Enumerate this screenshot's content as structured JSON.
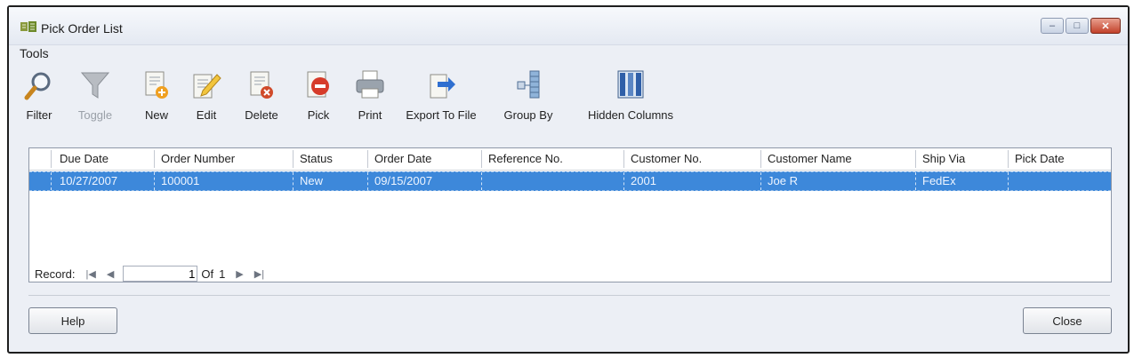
{
  "window": {
    "title": "Pick Order List",
    "controls": {
      "minimize": "–",
      "maximize": "□",
      "close": "✕"
    }
  },
  "menu": {
    "tools": "Tools"
  },
  "toolbar": {
    "items": [
      {
        "label": "Filter",
        "icon": "magnifier-icon"
      },
      {
        "label": "Toggle",
        "icon": "funnel-icon",
        "disabled": true
      },
      {
        "label": "New",
        "icon": "new-document-icon"
      },
      {
        "label": "Edit",
        "icon": "edit-pencil-icon"
      },
      {
        "label": "Delete",
        "icon": "delete-document-icon"
      },
      {
        "label": "Pick",
        "icon": "pick-stop-icon"
      },
      {
        "label": "Print",
        "icon": "printer-icon"
      },
      {
        "label": "Export To File",
        "icon": "export-arrow-icon"
      },
      {
        "label": "Group By",
        "icon": "group-by-icon"
      },
      {
        "label": "Hidden Columns",
        "icon": "columns-icon"
      }
    ]
  },
  "grid": {
    "columns": [
      "Due Date",
      "Order Number",
      "Status",
      "Order Date",
      "Reference No.",
      "Customer No.",
      "Customer Name",
      "Ship Via",
      "Pick Date"
    ],
    "rows": [
      [
        "10/27/2007",
        "100001",
        "New",
        "09/15/2007",
        "",
        "2001",
        "Joe R",
        "FedEx",
        ""
      ]
    ],
    "selected_row_color": "#3d88da"
  },
  "navigator": {
    "label": "Record:",
    "current": "1",
    "of_text": "Of",
    "total": "1"
  },
  "buttons": {
    "help": "Help",
    "close": "Close"
  }
}
